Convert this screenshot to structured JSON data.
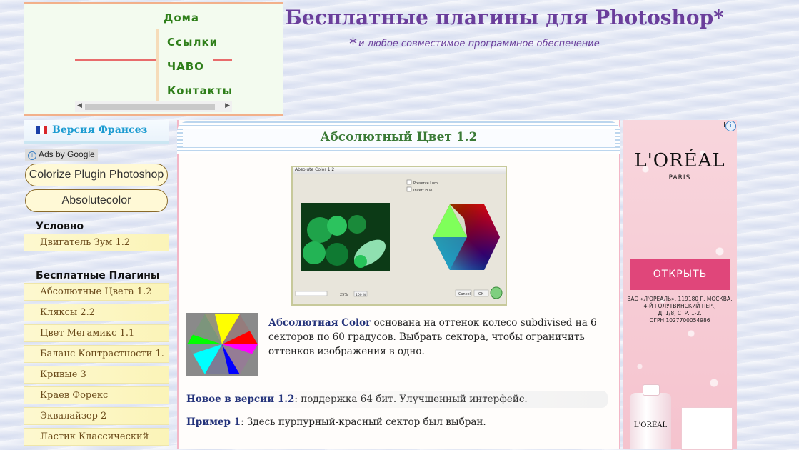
{
  "nav": {
    "items": [
      "Дома",
      "Ссылки",
      "ЧАВО",
      "Контакты"
    ]
  },
  "header": {
    "title": "Бесплатные плагины для Photoshop*",
    "asterisk": "*",
    "subtitle": "и любое совместимое программное обеспечение"
  },
  "sidebar": {
    "lang_link": "Версия Франсез",
    "ads_label": "Ads by Google",
    "ad_links": [
      "Colorize Plugin Photoshop",
      "Absolutecolor"
    ],
    "section1_title": "Условно",
    "section1_items": [
      "Двигатель Зум 1.2"
    ],
    "section2_title": "Бесплатные Плагины",
    "section2_items": [
      "Абсолютные Цвета 1.2",
      "Кляксы 2.2",
      "Цвет Мегамикс 1.1",
      "Баланс Контрастности 1.",
      "Кривые 3",
      "Краев Форекс",
      "Эквалайзер 2",
      "Ластик Классический"
    ]
  },
  "main": {
    "heading": "Абсолютный Цвет 1.2",
    "screenshot": {
      "window_title": "Absolute Color 1.2",
      "checkbox1": "Preserve Lum",
      "checkbox2": "Invert Hue",
      "cancel": "Cancel",
      "ok": "OK",
      "zoom": "25%",
      "zoom_btn": "100 %"
    },
    "intro_bold": "Абсолютная Color",
    "intro_text": " основана на оттенок колесо subdivised на 6 секторов по 60 градусов. Выбрать сектора, чтобы ограничить оттенков изображения в одно.",
    "news_bold": "Новое в версии 1.2",
    "news_text": ": поддержка 64 бит. Улучшенный интерфейс.",
    "example_bold": "Пример 1",
    "example_text": ": Здесь пурпурный-красный сектор был выбран."
  },
  "ad": {
    "corner": "i",
    "brand": "L'ORÉAL",
    "city": "PARIS",
    "button": "ОТКРЫТЬ",
    "legal": "ЗАО «Л'ОРЕАЛЬ», 119180 Г. МОСКВА,\n4-Й ГОЛУТВИНСКИЙ ПЕР.,\nД. 1/8, СТР. 1-2.\nОГРН 1027700054986",
    "bottle_label": "L'ORÉAL"
  },
  "colors": {
    "title": "#6a3e9b",
    "nav": "#2f7f1a",
    "heading": "#3a7a36",
    "ad_button": "#e0467a",
    "lang_link": "#1b9bd1"
  }
}
